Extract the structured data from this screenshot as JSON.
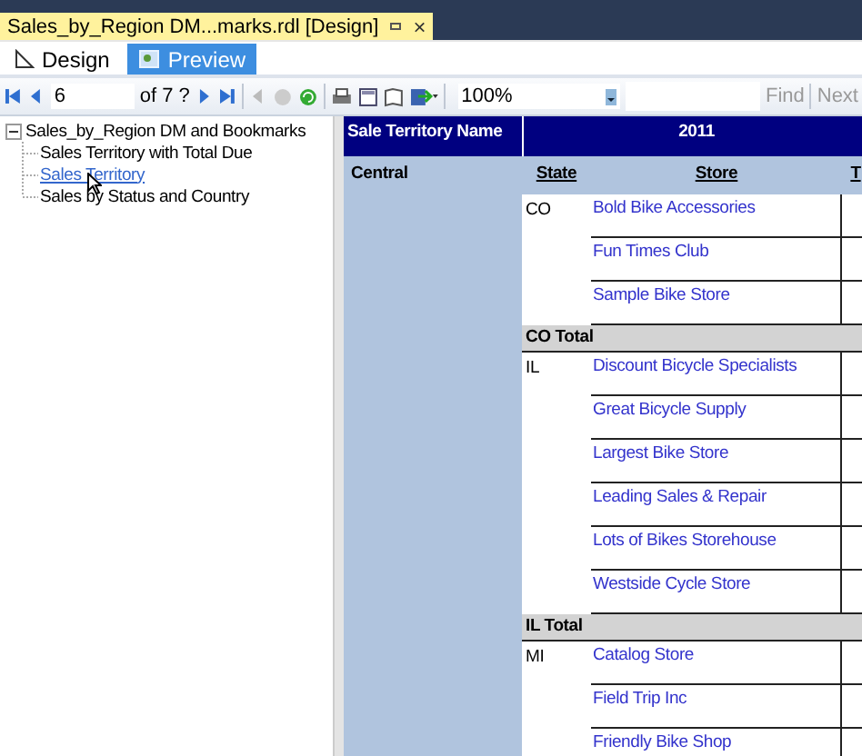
{
  "document_tab": {
    "title": "Sales_by_Region DM...marks.rdl [Design]",
    "close": "×"
  },
  "view_tabs": [
    {
      "label": "Design",
      "selected": false
    },
    {
      "label": "Preview",
      "selected": true
    }
  ],
  "toolbar": {
    "page": "6",
    "page_count": "of 7 ?",
    "zoom": "100%",
    "find": "Find",
    "next": "Next",
    "back_disabled": true,
    "stop_disabled": true
  },
  "document_map": {
    "label": "Sales_by_Region DM and Bookmarks",
    "expanded": true,
    "children": [
      {
        "label": "Sales Territory with Total Due",
        "selected": false
      },
      {
        "label": "Sales Territory",
        "selected": true
      },
      {
        "label": "Sales by Status and Country",
        "selected": false
      }
    ]
  },
  "report": {
    "territory_header": "Sale Territory Name",
    "year_header": "2011",
    "territory": "Central",
    "columns": [
      "State",
      "Store",
      "T"
    ],
    "groups": [
      {
        "state": "CO",
        "stores": [
          "Bold Bike Accessories",
          "Fun Times Club",
          "Sample Bike Store"
        ],
        "total": "CO Total"
      },
      {
        "state": "IL",
        "stores": [
          "Discount Bicycle Specialists",
          "Great Bicycle Supply",
          "Largest Bike Store",
          "Leading Sales & Repair",
          "Lots of Bikes Storehouse",
          "Westside Cycle Store"
        ],
        "total": "IL Total"
      },
      {
        "state": "MI",
        "stores": [
          "Catalog Store",
          "Field Trip Inc",
          "Friendly Bike Shop"
        ]
      }
    ]
  }
}
